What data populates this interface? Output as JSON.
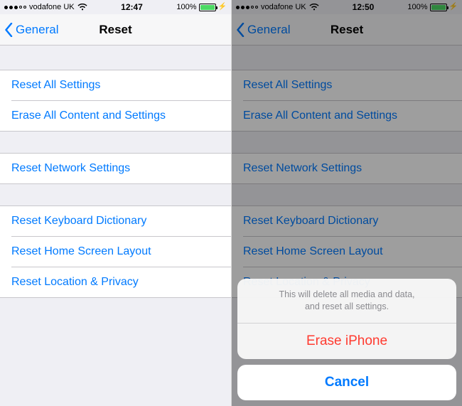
{
  "left": {
    "status": {
      "carrier": "vodafone UK",
      "time": "12:47",
      "battery_pct": "100%"
    },
    "nav": {
      "back": "General",
      "title": "Reset"
    },
    "groups": [
      {
        "items": [
          "Reset All Settings",
          "Erase All Content and Settings"
        ]
      },
      {
        "items": [
          "Reset Network Settings"
        ]
      },
      {
        "items": [
          "Reset Keyboard Dictionary",
          "Reset Home Screen Layout",
          "Reset Location & Privacy"
        ]
      }
    ]
  },
  "right": {
    "status": {
      "carrier": "vodafone UK",
      "time": "12:50",
      "battery_pct": "100%"
    },
    "nav": {
      "back": "General",
      "title": "Reset"
    },
    "groups": [
      {
        "items": [
          "Reset All Settings",
          "Erase All Content and Settings"
        ]
      },
      {
        "items": [
          "Reset Network Settings"
        ]
      },
      {
        "items": [
          "Reset Keyboard Dictionary",
          "Reset Home Screen Layout",
          "Reset Location & Privacy"
        ]
      }
    ],
    "action_sheet": {
      "message_line1": "This will delete all media and data,",
      "message_line2": "and reset all settings.",
      "destructive": "Erase iPhone",
      "cancel": "Cancel"
    }
  }
}
